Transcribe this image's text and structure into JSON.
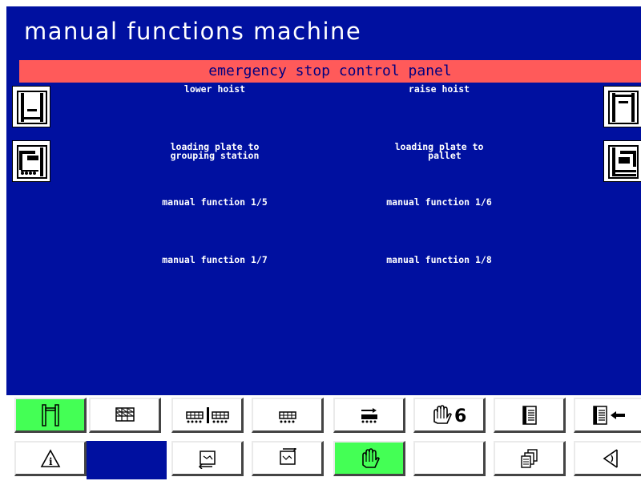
{
  "window": {
    "title": "manual functions machine"
  },
  "banner": {
    "text": "emergency stop control panel"
  },
  "functions": [
    {
      "id": "lower-hoist",
      "label": "lower hoist"
    },
    {
      "id": "raise-hoist",
      "label": "raise hoist"
    },
    {
      "id": "plate-to-grouping",
      "label": "loading plate to\ngrouping station"
    },
    {
      "id": "plate-to-pallet",
      "label": "loading plate to\n  pallet"
    },
    {
      "id": "mf-1-5",
      "label": "manual function 1/5"
    },
    {
      "id": "mf-1-6",
      "label": "manual function 1/6"
    },
    {
      "id": "mf-1-7",
      "label": "manual function 1/7"
    },
    {
      "id": "mf-1-8",
      "label": "manual function 1/8"
    }
  ],
  "colors": {
    "screen_bg": "#0010a0",
    "banner_bg": "#ff5a5a",
    "active_button": "#44ff55"
  },
  "toolbar_row1": [
    {
      "icon": "hoist-frame-icon",
      "active": true
    },
    {
      "icon": "pallet-grid-icon",
      "active": false
    },
    {
      "icon": "conveyor-split-icon",
      "active": false
    },
    {
      "icon": "conveyor-icon",
      "active": false
    },
    {
      "icon": "conveyor-arrow-icon",
      "active": false
    },
    {
      "icon": "hand-6-icon",
      "active": false
    },
    {
      "icon": "document-list-icon",
      "active": false
    },
    {
      "icon": "document-back-icon",
      "active": false
    }
  ],
  "toolbar_row2": [
    {
      "icon": "info-warning-icon",
      "active": false
    },
    {
      "icon": "empty-slot",
      "active": false
    },
    {
      "icon": "cycle-left-icon",
      "active": false
    },
    {
      "icon": "cycle-right-icon",
      "active": false
    },
    {
      "icon": "hand-manual-icon",
      "active": true
    },
    {
      "icon": "blank-button",
      "active": false
    },
    {
      "icon": "documents-stack-icon",
      "active": false
    },
    {
      "icon": "speaker-icon",
      "active": false
    }
  ],
  "toolbar_text": {
    "hand6_digit": "6"
  }
}
